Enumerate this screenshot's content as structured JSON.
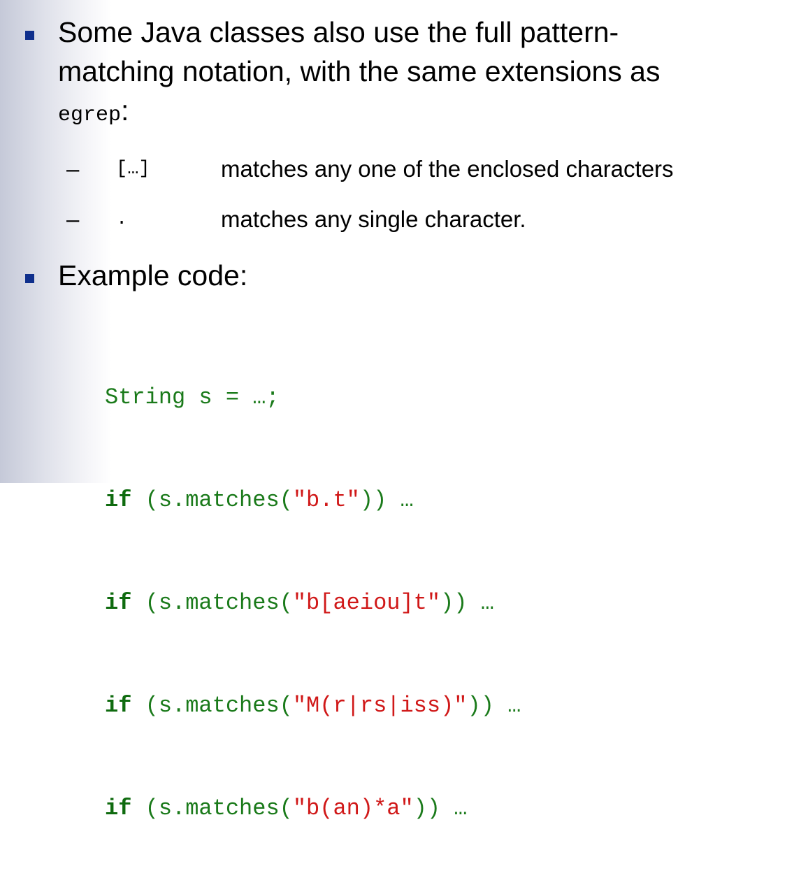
{
  "bullet_1": {
    "line1": "Some Java classes also use the full pattern-",
    "line2": "matching notation, with the same extensions as",
    "code_word": "egrep",
    "after_code": ":"
  },
  "sub_items": [
    {
      "dash": "–",
      "code": "[…]",
      "description": "matches any one of the enclosed characters"
    },
    {
      "dash": "–",
      "code": ".",
      "description": "matches any single character."
    }
  ],
  "bullet_2": {
    "text": "Example code:"
  },
  "code_lines": [
    {
      "full": "String s = …;"
    },
    {
      "keyword": "if",
      "open": " (s.matches(",
      "pattern": "\"b.t\"",
      "close": ")) …"
    },
    {
      "keyword": "if",
      "open": " (s.matches(",
      "pattern": "\"b[aeiou]t\"",
      "close": ")) …"
    },
    {
      "keyword": "if",
      "open": " (s.matches(",
      "pattern": "\"M(r|rs|iss)\"",
      "close": ")) …"
    },
    {
      "keyword": "if",
      "open": " (s.matches(",
      "pattern": "\"b(an)*a\"",
      "close": ")) …"
    }
  ],
  "colors": {
    "bullet": "#0f2f8c",
    "code_green": "#1a7a1a",
    "code_red": "#d01818"
  }
}
